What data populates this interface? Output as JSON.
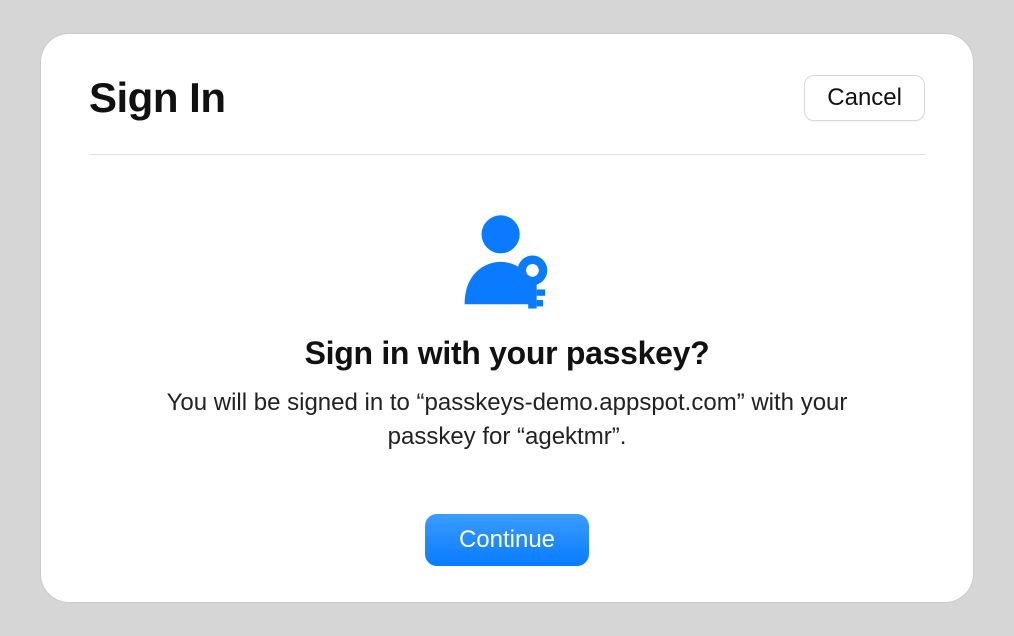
{
  "header": {
    "title": "Sign In",
    "cancel_label": "Cancel"
  },
  "body": {
    "icon_color": "#0a7bff",
    "heading": "Sign in with your passkey?",
    "description": "You will be signed in to “passkeys-demo.appspot.com” with your passkey for “agektmr”."
  },
  "footer": {
    "continue_label": "Continue"
  }
}
